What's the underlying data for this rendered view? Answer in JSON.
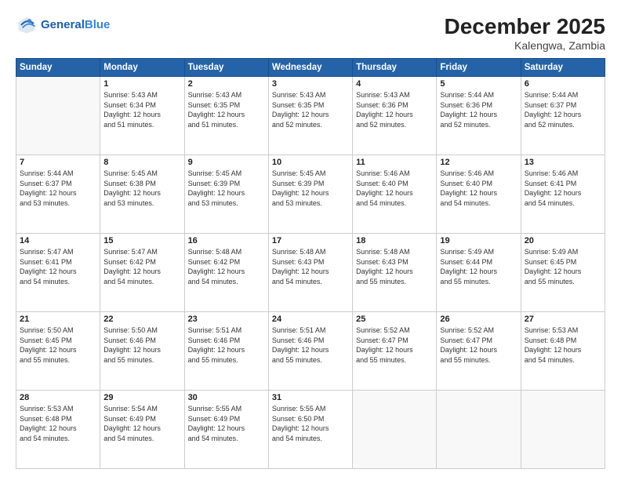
{
  "header": {
    "logo_line1": "General",
    "logo_line2": "Blue",
    "main_title": "December 2025",
    "subtitle": "Kalengwa, Zambia"
  },
  "columns": [
    "Sunday",
    "Monday",
    "Tuesday",
    "Wednesday",
    "Thursday",
    "Friday",
    "Saturday"
  ],
  "weeks": [
    [
      {
        "day": "",
        "info": ""
      },
      {
        "day": "1",
        "info": "Sunrise: 5:43 AM\nSunset: 6:34 PM\nDaylight: 12 hours\nand 51 minutes."
      },
      {
        "day": "2",
        "info": "Sunrise: 5:43 AM\nSunset: 6:35 PM\nDaylight: 12 hours\nand 51 minutes."
      },
      {
        "day": "3",
        "info": "Sunrise: 5:43 AM\nSunset: 6:35 PM\nDaylight: 12 hours\nand 52 minutes."
      },
      {
        "day": "4",
        "info": "Sunrise: 5:43 AM\nSunset: 6:36 PM\nDaylight: 12 hours\nand 52 minutes."
      },
      {
        "day": "5",
        "info": "Sunrise: 5:44 AM\nSunset: 6:36 PM\nDaylight: 12 hours\nand 52 minutes."
      },
      {
        "day": "6",
        "info": "Sunrise: 5:44 AM\nSunset: 6:37 PM\nDaylight: 12 hours\nand 52 minutes."
      }
    ],
    [
      {
        "day": "7",
        "info": "Sunrise: 5:44 AM\nSunset: 6:37 PM\nDaylight: 12 hours\nand 53 minutes."
      },
      {
        "day": "8",
        "info": "Sunrise: 5:45 AM\nSunset: 6:38 PM\nDaylight: 12 hours\nand 53 minutes."
      },
      {
        "day": "9",
        "info": "Sunrise: 5:45 AM\nSunset: 6:39 PM\nDaylight: 12 hours\nand 53 minutes."
      },
      {
        "day": "10",
        "info": "Sunrise: 5:45 AM\nSunset: 6:39 PM\nDaylight: 12 hours\nand 53 minutes."
      },
      {
        "day": "11",
        "info": "Sunrise: 5:46 AM\nSunset: 6:40 PM\nDaylight: 12 hours\nand 54 minutes."
      },
      {
        "day": "12",
        "info": "Sunrise: 5:46 AM\nSunset: 6:40 PM\nDaylight: 12 hours\nand 54 minutes."
      },
      {
        "day": "13",
        "info": "Sunrise: 5:46 AM\nSunset: 6:41 PM\nDaylight: 12 hours\nand 54 minutes."
      }
    ],
    [
      {
        "day": "14",
        "info": "Sunrise: 5:47 AM\nSunset: 6:41 PM\nDaylight: 12 hours\nand 54 minutes."
      },
      {
        "day": "15",
        "info": "Sunrise: 5:47 AM\nSunset: 6:42 PM\nDaylight: 12 hours\nand 54 minutes."
      },
      {
        "day": "16",
        "info": "Sunrise: 5:48 AM\nSunset: 6:42 PM\nDaylight: 12 hours\nand 54 minutes."
      },
      {
        "day": "17",
        "info": "Sunrise: 5:48 AM\nSunset: 6:43 PM\nDaylight: 12 hours\nand 54 minutes."
      },
      {
        "day": "18",
        "info": "Sunrise: 5:48 AM\nSunset: 6:43 PM\nDaylight: 12 hours\nand 55 minutes."
      },
      {
        "day": "19",
        "info": "Sunrise: 5:49 AM\nSunset: 6:44 PM\nDaylight: 12 hours\nand 55 minutes."
      },
      {
        "day": "20",
        "info": "Sunrise: 5:49 AM\nSunset: 6:45 PM\nDaylight: 12 hours\nand 55 minutes."
      }
    ],
    [
      {
        "day": "21",
        "info": "Sunrise: 5:50 AM\nSunset: 6:45 PM\nDaylight: 12 hours\nand 55 minutes."
      },
      {
        "day": "22",
        "info": "Sunrise: 5:50 AM\nSunset: 6:46 PM\nDaylight: 12 hours\nand 55 minutes."
      },
      {
        "day": "23",
        "info": "Sunrise: 5:51 AM\nSunset: 6:46 PM\nDaylight: 12 hours\nand 55 minutes."
      },
      {
        "day": "24",
        "info": "Sunrise: 5:51 AM\nSunset: 6:46 PM\nDaylight: 12 hours\nand 55 minutes."
      },
      {
        "day": "25",
        "info": "Sunrise: 5:52 AM\nSunset: 6:47 PM\nDaylight: 12 hours\nand 55 minutes."
      },
      {
        "day": "26",
        "info": "Sunrise: 5:52 AM\nSunset: 6:47 PM\nDaylight: 12 hours\nand 55 minutes."
      },
      {
        "day": "27",
        "info": "Sunrise: 5:53 AM\nSunset: 6:48 PM\nDaylight: 12 hours\nand 54 minutes."
      }
    ],
    [
      {
        "day": "28",
        "info": "Sunrise: 5:53 AM\nSunset: 6:48 PM\nDaylight: 12 hours\nand 54 minutes."
      },
      {
        "day": "29",
        "info": "Sunrise: 5:54 AM\nSunset: 6:49 PM\nDaylight: 12 hours\nand 54 minutes."
      },
      {
        "day": "30",
        "info": "Sunrise: 5:55 AM\nSunset: 6:49 PM\nDaylight: 12 hours\nand 54 minutes."
      },
      {
        "day": "31",
        "info": "Sunrise: 5:55 AM\nSunset: 6:50 PM\nDaylight: 12 hours\nand 54 minutes."
      },
      {
        "day": "",
        "info": ""
      },
      {
        "day": "",
        "info": ""
      },
      {
        "day": "",
        "info": ""
      }
    ]
  ]
}
